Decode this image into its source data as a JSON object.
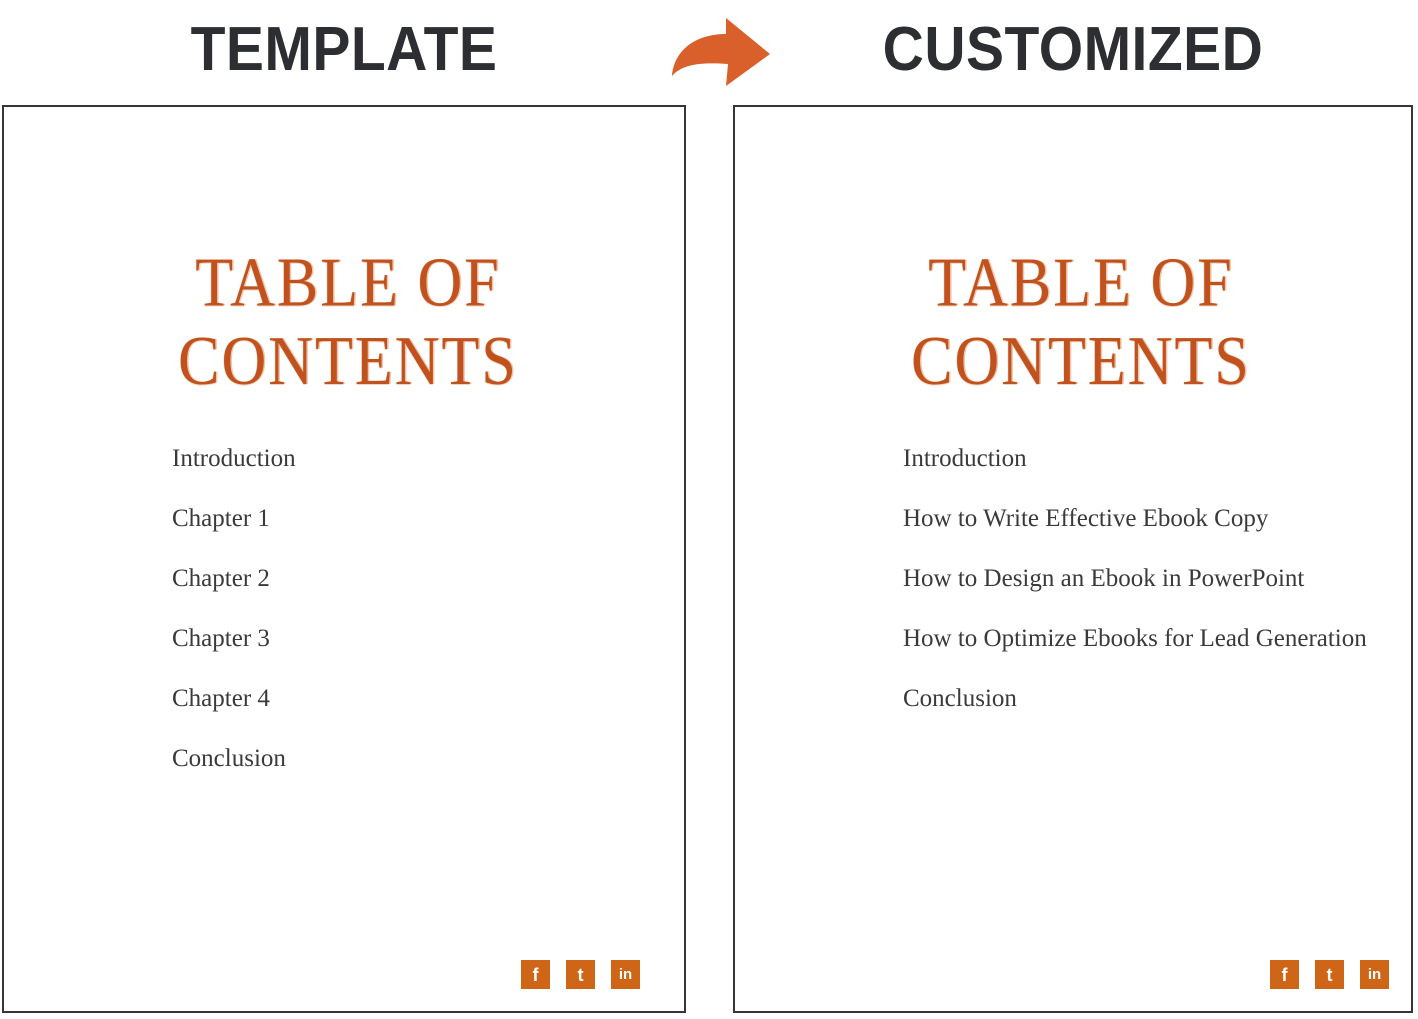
{
  "header": {
    "left_label": "TEMPLATE",
    "right_label": "CUSTOMIZED",
    "arrow_icon": "curved-arrow-right-icon",
    "text_color": "#2d2e31",
    "arrow_color": "#d9602b"
  },
  "theme": {
    "accent_orange": "#c1521d",
    "icon_orange": "#cf6516",
    "body_text": "#3a3a3c",
    "panel_border": "#35363a",
    "background": "#ffffff"
  },
  "template_slide": {
    "title": "TABLE OF\nCONTENTS",
    "items": [
      "Introduction",
      "Chapter 1",
      "Chapter 2",
      "Chapter 3",
      "Chapter 4",
      "Conclusion"
    ],
    "social": [
      {
        "name": "facebook",
        "glyph": "f"
      },
      {
        "name": "twitter",
        "glyph": "t"
      },
      {
        "name": "linkedin",
        "glyph": "in"
      }
    ]
  },
  "customized_slide": {
    "title": "TABLE OF\nCONTENTS",
    "items": [
      "Introduction",
      "How to Write Effective Ebook Copy",
      "How to Design an Ebook in PowerPoint",
      "How to Optimize Ebooks for Lead Generation",
      "Conclusion"
    ],
    "social": [
      {
        "name": "facebook",
        "glyph": "f"
      },
      {
        "name": "twitter",
        "glyph": "t"
      },
      {
        "name": "linkedin",
        "glyph": "in"
      }
    ]
  }
}
